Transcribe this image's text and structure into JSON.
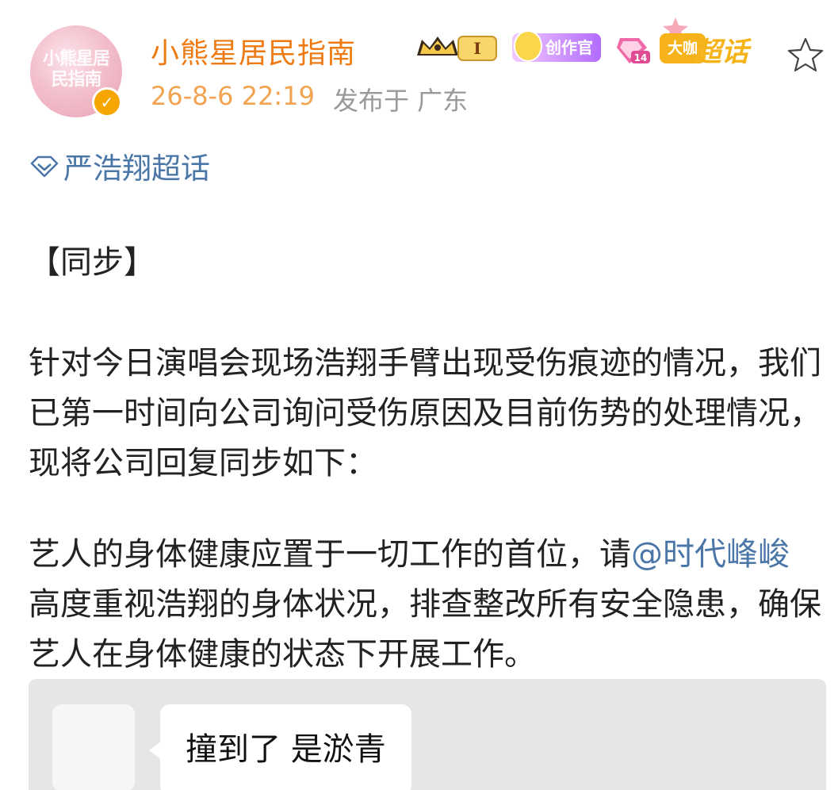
{
  "post": {
    "author": {
      "name": "小熊星居民指南",
      "avatar_text": "小熊星居民指南"
    },
    "badges": {
      "level": "I",
      "creator": "创作官",
      "gem_level": "14",
      "daka_card": "大咖",
      "daka_big": "超话"
    },
    "meta": {
      "time": "26-8-6 22:19",
      "location": "发布于 广东"
    },
    "topic": "严浩翔超话",
    "body": {
      "p1": "【同步】",
      "p2": "针对今日演唱会现场浩翔手臂出现受伤痕迹的情况，我们已第一时间向公司询问受伤原因及目前伤势的处理情况，现将公司回复同步如下：",
      "p3_before": "艺人的身体健康应置于一切工作的首位，请",
      "p3_mention": "@时代峰峻",
      "p3_after": " 高度重视浩翔的身体状况，排查整改所有安全隐患，确保艺人在身体健康的状态下开展工作。"
    },
    "quote": {
      "message": "撞到了 是淤青"
    }
  },
  "colors": {
    "username": "#ee7a12",
    "time": "#f2a350",
    "link": "#4a76a8",
    "verified": "#f7a600"
  }
}
